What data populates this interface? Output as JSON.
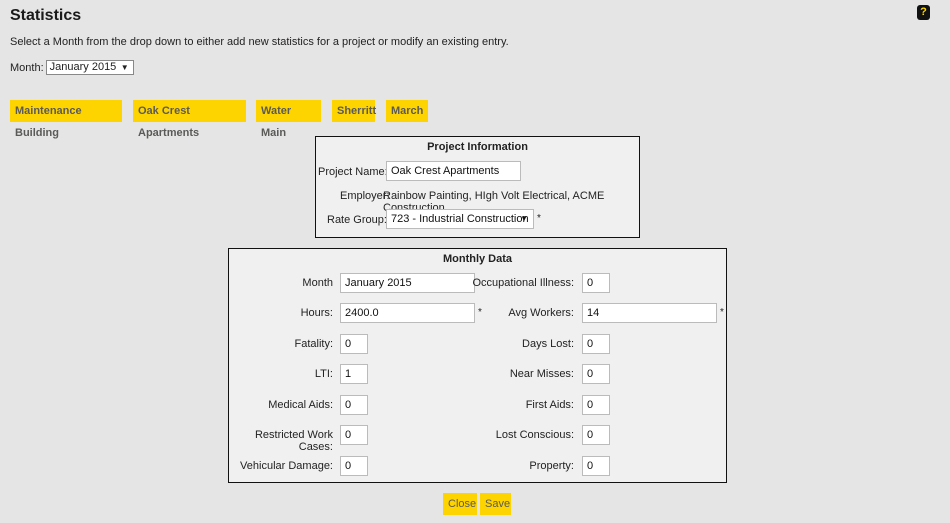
{
  "page": {
    "title": "Statistics",
    "intro": "Select a Month from the drop down to either add new statistics for a project or modify an existing entry.",
    "month_label": "Month:",
    "month_value": "January 2015",
    "help_icon_glyph": "?"
  },
  "projects": [
    "Maintenance Building",
    "Oak Crest Apartments",
    "Water Main",
    "Sherritt",
    "March"
  ],
  "project_info": {
    "title": "Project Information",
    "project_name_label": "Project Name:",
    "project_name_value": "Oak Crest Apartments",
    "employer_label": "Employer:",
    "employer_value": "Rainbow Painting, HIgh Volt Electrical, ACME Construction",
    "rate_group_label": "Rate Group:",
    "rate_group_value": "723 - Industrial Construction",
    "required_mark": "*"
  },
  "monthly": {
    "title": "Monthly Data",
    "month_label": "Month",
    "month_value": "January 2015",
    "hours_label": "Hours:",
    "hours_value": "2400.0",
    "fatality_label": "Fatality:",
    "fatality_value": "0",
    "lti_label": "LTI:",
    "lti_value": "1",
    "medical_label": "Medical Aids:",
    "medical_value": "0",
    "restricted_label": "Restricted Work Cases:",
    "restricted_value": "0",
    "vehicular_label": "Vehicular Damage:",
    "vehicular_value": "0",
    "occupational_label": "Occupational Illness:",
    "occupational_value": "0",
    "avg_workers_label": "Avg Workers:",
    "avg_workers_value": "14",
    "days_lost_label": "Days Lost:",
    "days_lost_value": "0",
    "near_misses_label": "Near Misses:",
    "near_misses_value": "0",
    "first_aids_label": "First Aids:",
    "first_aids_value": "0",
    "lost_conscious_label": "Lost Conscious:",
    "lost_conscious_value": "0",
    "property_label": "Property:",
    "property_value": "0",
    "required_mark": "*"
  },
  "actions": {
    "close": "Close",
    "save": "Save"
  },
  "colors": {
    "accent": "#fed400",
    "background": "#e6e5e5",
    "panel": "#f0f0f0"
  }
}
